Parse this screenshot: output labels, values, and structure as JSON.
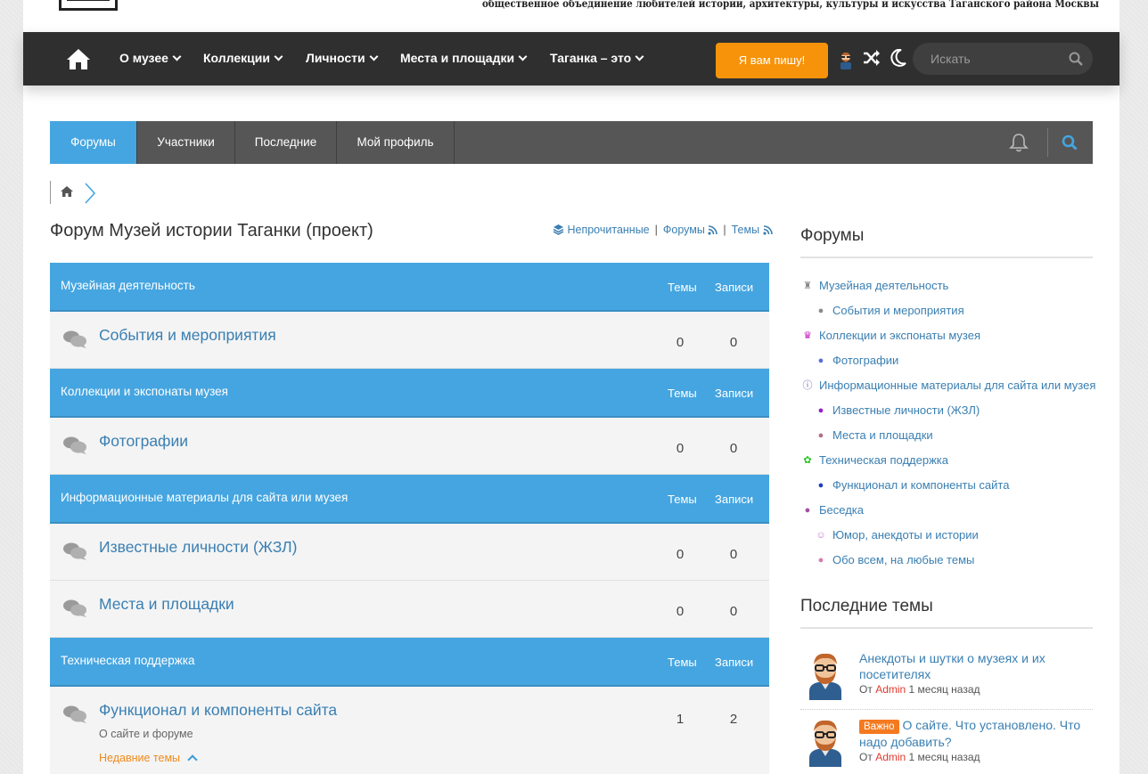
{
  "banner": {
    "tagline": "общественное объединение любителей истории, архитектуры, культуры и искусства Таганского района Москвы"
  },
  "mainnav": {
    "items": [
      {
        "label": "О музее"
      },
      {
        "label": "Коллекции"
      },
      {
        "label": "Личности"
      },
      {
        "label": "Места и площадки"
      },
      {
        "label": "Таганка – это"
      }
    ],
    "write_button": "Я вам пишу!",
    "search_placeholder": "Искать"
  },
  "forumbar": {
    "tabs": [
      {
        "label": "Форумы",
        "active": true
      },
      {
        "label": "Участники"
      },
      {
        "label": "Последние"
      },
      {
        "label": "Мой профиль"
      }
    ]
  },
  "forum": {
    "title": "Форум Музей истории Таганки (проект)",
    "quicklinks": {
      "unread": "Непрочитанные",
      "forums": "Форумы",
      "topics": "Темы"
    },
    "col_topics": "Темы",
    "col_posts": "Записи",
    "categories": [
      {
        "name": "Музейная деятельность",
        "forums": [
          {
            "name": "События и мероприятия",
            "topics": "0",
            "posts": "0"
          }
        ]
      },
      {
        "name": "Коллекции и экспонаты музея",
        "forums": [
          {
            "name": "Фотографии",
            "topics": "0",
            "posts": "0"
          }
        ]
      },
      {
        "name": "Информационные материалы для сайта или музея",
        "forums": [
          {
            "name": "Известные личности (ЖЗЛ)",
            "topics": "0",
            "posts": "0"
          },
          {
            "name": "Места и площадки",
            "topics": "0",
            "posts": "0"
          }
        ]
      },
      {
        "name": "Техническая поддержка",
        "forums": [
          {
            "name": "Функционал и компоненты сайта",
            "topics": "1",
            "posts": "2",
            "description": "О сайте и форуме",
            "recent": "Недавние темы"
          }
        ]
      }
    ]
  },
  "sidebar": {
    "forums_title": "Форумы",
    "forum_list": [
      {
        "label": "Музейная деятельность",
        "level": 0,
        "icon": "museum-icon",
        "color": "#8a8a8a"
      },
      {
        "label": "События и мероприятия",
        "level": 1,
        "icon": "comments-icon",
        "color": "#8a8a8a"
      },
      {
        "label": "Коллекции и экспонаты музея",
        "level": 0,
        "icon": "chess-icon",
        "color": "#c21fb8"
      },
      {
        "label": "Фотографии",
        "level": 1,
        "icon": "comments-icon",
        "color": "#5b6ed6"
      },
      {
        "label": "Информационные материалы для сайта или музея",
        "level": 0,
        "icon": "info-icon",
        "color": "#6b5fa8"
      },
      {
        "label": "Известные личности (ЖЗЛ)",
        "level": 1,
        "icon": "comments-icon",
        "color": "#9a1fc2"
      },
      {
        "label": "Места и площадки",
        "level": 1,
        "icon": "comments-icon",
        "color": "#b0708a"
      },
      {
        "label": "Техническая поддержка",
        "level": 0,
        "icon": "gear-icon",
        "color": "#27c21f"
      },
      {
        "label": "Функционал и компоненты сайта",
        "level": 1,
        "icon": "comments-icon",
        "color": "#1f3fc2"
      },
      {
        "label": "Беседка",
        "level": 0,
        "icon": "comments-icon",
        "color": "#a0529e"
      },
      {
        "label": "Юмор, анекдоты и истории",
        "level": 1,
        "icon": "smile-icon",
        "color": "#c27ad0"
      },
      {
        "label": "Обо всем, на любые темы",
        "level": 1,
        "icon": "comments-icon",
        "color": "#d87ab0"
      }
    ],
    "latest_title": "Последние темы",
    "latest": [
      {
        "title": "Анекдоты и шутки о музеях и их посетителях",
        "by": "От",
        "author": "Admin",
        "when": "1 месяц назад"
      },
      {
        "badge": "Важно",
        "title": "О сайте. Что установлено. Что надо добавить?",
        "by": "От",
        "author": "Admin",
        "when": "1 месяц назад"
      }
    ]
  }
}
